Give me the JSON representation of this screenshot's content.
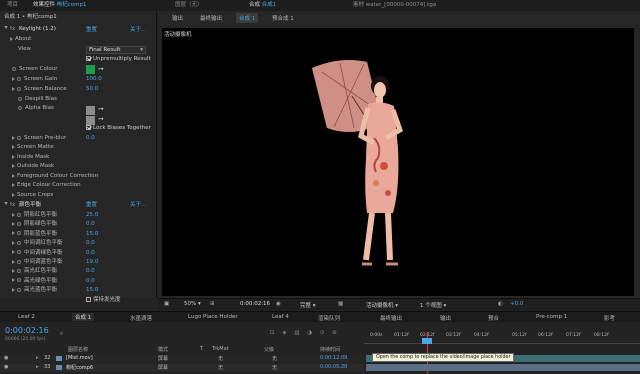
{
  "top_tabs": {
    "left": [
      "项目",
      "效果控件",
      "枸杞comp1"
    ],
    "composition_tab_prefix": "合成",
    "composition_tab_name": "合成1",
    "layer_tab": "图层（无）",
    "footage_tab": "素材 water_[00000-00074].tga"
  },
  "effect_controls": {
    "breadcrumb": "合成 1 • 枸杞comp1",
    "keylight_title": "Keylight (1.2)",
    "reset": "重置",
    "about": "关于...",
    "about_row": "About",
    "view_label": "View",
    "view_value": "Final Result",
    "unpremultiply": "Unpremultiply Result",
    "screen_colour": "Screen Colour",
    "screen_colour_hex": "#1e9c4a",
    "screen_gain": "Screen Gain",
    "screen_gain_value": "100.0",
    "screen_balance": "Screen Balance",
    "screen_balance_value": "50.0",
    "despill_bias": "Despill Bias",
    "alpha_bias": "Alpha Bias",
    "lock_biases": "Lock Biases Together",
    "screen_preblur": "Screen Pre-blur",
    "screen_preblur_value": "0.0",
    "groups": [
      "Screen Matte",
      "Inside Mask",
      "Outside Mask",
      "Foreground Colour Correction",
      "Edge Colour Correction",
      "Source Crops"
    ],
    "color_balance_title": "颜色平衡",
    "color_balance_params": [
      {
        "label": "阴影红色平衡",
        "value": "25.0"
      },
      {
        "label": "阴影绿色平衡",
        "value": "0.0"
      },
      {
        "label": "阴影蓝色平衡",
        "value": "15.0"
      },
      {
        "label": "中间调红色平衡",
        "value": "0.0"
      },
      {
        "label": "中间调绿色平衡",
        "value": "0.0"
      },
      {
        "label": "中间调蓝色平衡",
        "value": "19.0"
      },
      {
        "label": "高光红色平衡",
        "value": "0.0"
      },
      {
        "label": "高光绿色平衡",
        "value": "0.0"
      },
      {
        "label": "高光蓝色平衡",
        "value": "15.0"
      }
    ],
    "preserve_luminosity": "保持发光度"
  },
  "viewer": {
    "nav_items": [
      "输出",
      "最终输出",
      "合成 1",
      "预合成 1"
    ],
    "canvas_label": "活动摄像机",
    "zoom": "50%",
    "timecode": "0:00:02:16",
    "quality": "完整",
    "camera": "活动摄像机",
    "views": "1 个视图",
    "exposure": "+0.0"
  },
  "timeline": {
    "tabs": [
      "Leaf 2",
      "合成 1",
      "水墨滴落",
      "Lugo Place Holder",
      "Leaf 4",
      "渲染队列",
      "最终输出",
      "输出",
      "预合",
      "Pre-comp 1",
      "影考"
    ],
    "timecode": "0:00:02:16",
    "frame_info": "00066 (25.00 fps)",
    "columns": [
      "图层名称",
      "模式",
      "T",
      "TrkMat",
      "父级",
      "持续时间"
    ],
    "ruler": [
      "0:00s",
      "01:12f",
      "02:12f",
      "03:12f",
      "04:12f",
      "05:12f",
      "06:12f",
      "07:12f",
      "08:12f"
    ],
    "layers": [
      {
        "num": "32",
        "name": "[Mist.mov]",
        "mode": "屏幕",
        "trkmat": "无",
        "parent": "无",
        "duration": "0:00:12:09"
      },
      {
        "num": "33",
        "name": "枸杞comp6",
        "mode": "屏幕",
        "trkmat": "无",
        "parent": "无",
        "duration": "0:00:05:20"
      }
    ],
    "tooltip": "Open the comp to replace the video/image place holder"
  }
}
